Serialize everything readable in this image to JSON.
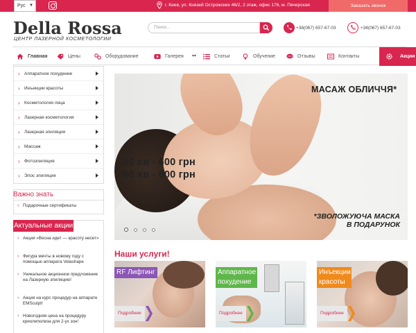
{
  "topbar": {
    "language": "Рус",
    "address": "г. Киев, ул. Князей Острожских 46/2, 2 этаж, офис 176, м. Печерская",
    "callback_label": "Заказать звонок"
  },
  "header": {
    "logo_main": "Della Rossa",
    "logo_sub": "ЦЕНТР ЛАЗЕРНОЙ КОСМЕТОЛОГИИ",
    "search_placeholder": "Поиск...",
    "phone1": "+38(067) 657-67-03",
    "phone2": "+38(067) 657-67-03"
  },
  "nav": {
    "items": [
      {
        "label": "Главная",
        "icon": "home-icon"
      },
      {
        "label": "Цены",
        "icon": "tag-icon"
      },
      {
        "label": "Оборудование",
        "icon": "equipment-icon"
      },
      {
        "label": "Галерея",
        "icon": "youtube-icon"
      },
      {
        "label": "Статьи",
        "icon": "list-icon"
      },
      {
        "label": "Обучение",
        "icon": "lightbulb-icon"
      },
      {
        "label": "Отзывы",
        "icon": "chat-icon"
      },
      {
        "label": "Контакты",
        "icon": "contacts-icon"
      }
    ],
    "promo_label": "Акции"
  },
  "sidebar": {
    "menu": [
      "Аппаратное похудение",
      "Инъекции красоты",
      "Косметология лица",
      "Лазерная косметология",
      "Лазерная эпиляция",
      "Массаж",
      "Фотоэпиляция",
      "Элос эпиляция"
    ],
    "important_title": "Важно знать",
    "important_links": [
      "Подарочные сертификаты"
    ],
    "promos_title": "Актуальные акции",
    "promos": [
      "Акция «Весна идет — красоту несет»",
      "Фигура мечты в новому году с помощью аппарата Velashape",
      "Уникальное акционное предложение на Лазерную эпиляцию!",
      "Акция на курс процедур на аппарате EMSculpt!",
      "Новогодняя цена на процедуру криолиполиза для 2-ух зон!"
    ]
  },
  "slider": {
    "title": "МАСАЖ ОБЛИЧЧЯ*",
    "price1": "30 хв - 600 грн",
    "price2": "60 хв - 800 грн",
    "note_line1": "*ЗВОЛОЖУЮЧА МАСКА",
    "note_line2": "В ПОДАРУНОК",
    "dots_count": 4
  },
  "services": {
    "title": "Наши услуги!",
    "more_label": "Подробнее",
    "cards": [
      {
        "label": "RF Лифтинг",
        "color": "#8b56b5"
      },
      {
        "label": "Аппаратное похудение",
        "color": "#5fb64a"
      },
      {
        "label": "Инъекции красоты",
        "color": "#f08a1c"
      }
    ]
  },
  "colors": {
    "accent": "#d8264f",
    "callback": "#f06a6a"
  }
}
